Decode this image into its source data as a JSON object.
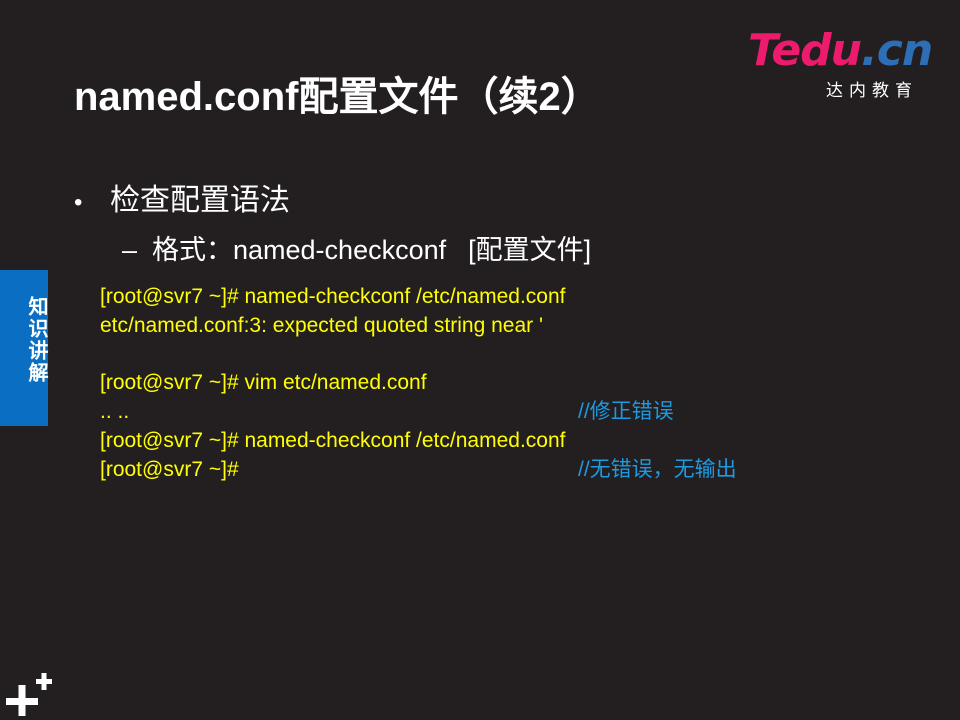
{
  "logo": {
    "brand_t": "T",
    "brand_edu": "edu",
    "brand_dot": ".",
    "brand_cn": "cn",
    "subtitle": "达内教育",
    "colors": {
      "pink": "#ec1b6d",
      "blue": "#2d6fb7"
    }
  },
  "slide": {
    "title": "named.conf配置文件（续2）",
    "bullet": "检查配置语法",
    "sub_label": "格式：named-checkconf",
    "sub_arg": "[配置文件]"
  },
  "code": {
    "lines": [
      {
        "text": "[root@svr7 ~]# named-checkconf  /etc/named.conf",
        "comment": ""
      },
      {
        "text": "etc/named.conf:3: expected quoted string near '",
        "comment": ""
      },
      {
        "text": "",
        "comment": ""
      },
      {
        "text": "[root@svr7 ~]# vim  etc/named.conf",
        "comment": ""
      },
      {
        "text": ".. ..",
        "comment": "//修正错误"
      },
      {
        "text": "[root@svr7 ~]# named-checkconf  /etc/named.conf",
        "comment": ""
      },
      {
        "text": "[root@svr7 ~]#",
        "comment": "//无错误，无输出"
      }
    ],
    "colors": {
      "command": "#ffff00",
      "comment": "#1e9ae0"
    }
  },
  "side_tab": {
    "label": "知识讲解",
    "color": "#0a6fc2"
  },
  "decor": {
    "plus_icon": "plus-plus-icon"
  }
}
